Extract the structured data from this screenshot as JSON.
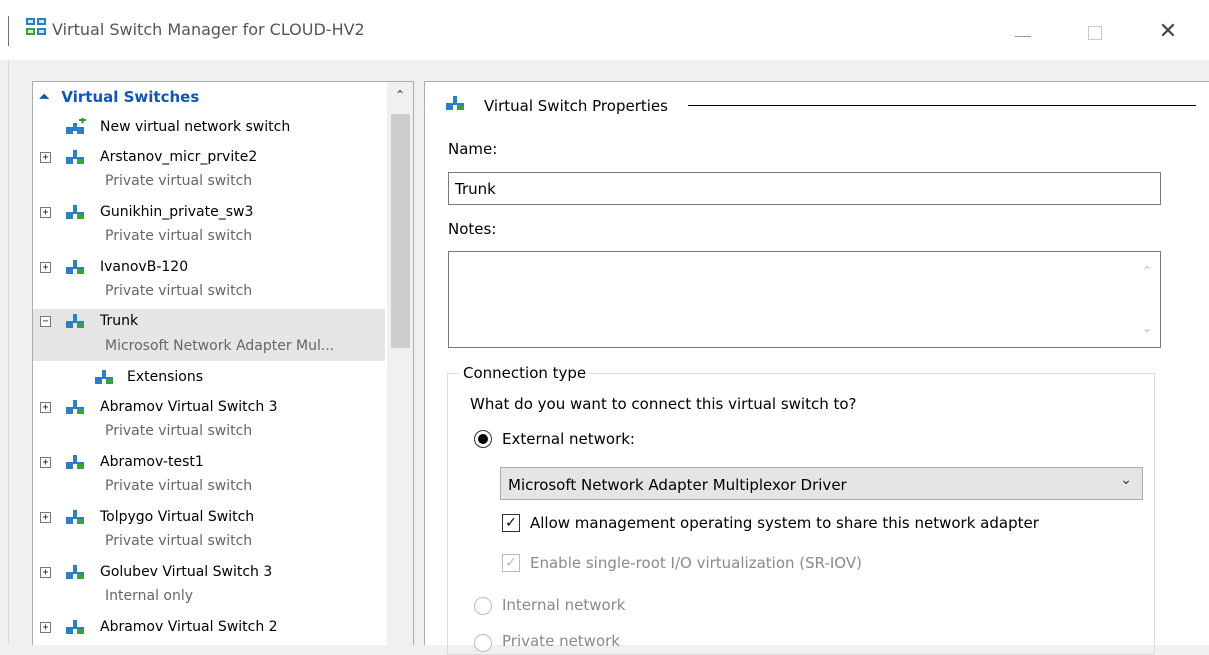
{
  "window": {
    "title": "Virtual Switch Manager for CLOUD-HV2",
    "minimize": "—",
    "close": "✕"
  },
  "left_panel": {
    "section_title": "Virtual Switches",
    "items": [
      {
        "name": "New virtual network switch"
      },
      {
        "name": "Arstanov_micr_prvite2",
        "subtitle": "Private virtual switch"
      },
      {
        "name": "Gunikhin_private_sw3",
        "subtitle": "Private virtual switch"
      },
      {
        "name": "IvanovB-120",
        "subtitle": "Private virtual switch"
      },
      {
        "name": "Trunk",
        "subtitle": "Microsoft Network Adapter Mul...",
        "selected": true
      },
      {
        "name": "Extensions"
      },
      {
        "name": "Abramov Virtual Switch 3",
        "subtitle": "Private virtual switch"
      },
      {
        "name": "Abramov-test1",
        "subtitle": "Private virtual switch"
      },
      {
        "name": "Tolpygo Virtual Switch",
        "subtitle": "Private virtual switch"
      },
      {
        "name": "Golubev Virtual Switch 3",
        "subtitle": "Internal only"
      },
      {
        "name": "Abramov Virtual Switch 2"
      }
    ]
  },
  "properties": {
    "header": "Virtual Switch Properties",
    "name_label": "Name:",
    "name_value": "Trunk",
    "notes_label": "Notes:",
    "notes_value": "",
    "connection_type": {
      "title": "Connection type",
      "question": "What do you want to connect this virtual switch to?",
      "external_label": "External network:",
      "adapter_selected": "Microsoft Network Adapter Multiplexor Driver",
      "allow_mgmt_label": "Allow management operating system to share this network adapter",
      "allow_mgmt_checked": true,
      "sriov_label": "Enable single-root I/O virtualization (SR-IOV)",
      "sriov_checked": true,
      "internal_label": "Internal network",
      "private_label": "Private network"
    }
  },
  "colors": {
    "section_title": "#0f56b8",
    "selected_row": "#e6e6e6",
    "window_bg": "#f0f0f0"
  }
}
